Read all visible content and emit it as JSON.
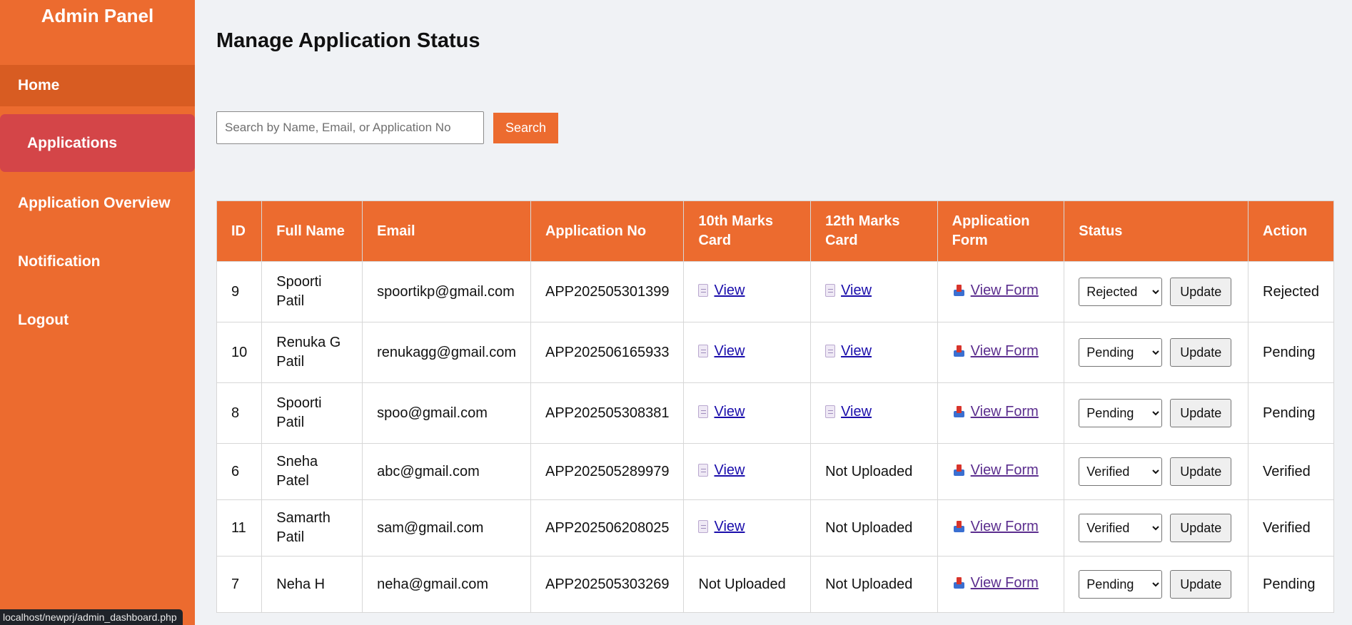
{
  "sidebar": {
    "title": "Admin Panel",
    "items": [
      {
        "label": "Home"
      },
      {
        "label": "Applications"
      },
      {
        "label": "Application Overview"
      },
      {
        "label": "Notification"
      },
      {
        "label": "Logout"
      }
    ]
  },
  "main": {
    "title": "Manage Application Status",
    "search": {
      "placeholder": "Search by Name, Email, or Application No",
      "value": "",
      "button_label": "Search"
    },
    "table": {
      "headers": [
        "ID",
        "Full Name",
        "Email",
        "Application No",
        "10th Marks Card",
        "12th Marks Card",
        "Application Form",
        "Status",
        "Action"
      ],
      "rows": [
        {
          "id": "9",
          "name": "Spoorti Patil",
          "email": "spoortikp@gmail.com",
          "app_no": "APP202505301399",
          "marks10": "View",
          "marks12": "View",
          "form": "View Form",
          "status_select": "Rejected",
          "update_label": "Update",
          "action": "Rejected"
        },
        {
          "id": "10",
          "name": "Renuka G Patil",
          "email": "renukagg@gmail.com",
          "app_no": "APP202506165933",
          "marks10": "View",
          "marks12": "View",
          "form": "View Form",
          "status_select": "Pending",
          "update_label": "Update",
          "action": "Pending"
        },
        {
          "id": "8",
          "name": "Spoorti Patil",
          "email": "spoo@gmail.com",
          "app_no": "APP202505308381",
          "marks10": "View",
          "marks12": "View",
          "form": "View Form",
          "status_select": "Pending",
          "update_label": "Update",
          "action": "Pending"
        },
        {
          "id": "6",
          "name": "Sneha Patel",
          "email": "abc@gmail.com",
          "app_no": "APP202505289979",
          "marks10": "View",
          "marks12": "Not Uploaded",
          "form": "View Form",
          "status_select": "Verified",
          "update_label": "Update",
          "action": "Verified"
        },
        {
          "id": "11",
          "name": "Samarth Patil",
          "email": "sam@gmail.com",
          "app_no": "APP202506208025",
          "marks10": "View",
          "marks12": "Not Uploaded",
          "form": "View Form",
          "status_select": "Verified",
          "update_label": "Update",
          "action": "Verified"
        },
        {
          "id": "7",
          "name": "Neha H",
          "email": "neha@gmail.com",
          "app_no": "APP202505303269",
          "marks10": "Not Uploaded",
          "marks12": "Not Uploaded",
          "form": "View Form",
          "status_select": "Pending",
          "update_label": "Update",
          "action": "Pending"
        }
      ]
    }
  },
  "status_bar": {
    "url": "localhost/newprj/admin_dashboard.php"
  },
  "colors": {
    "accent": "#ec6b2f",
    "active_nav": "#d44548",
    "home_nav": "#d85c22",
    "link": "#1a0dab",
    "visited_link": "#5b2d8e"
  },
  "icons": {
    "marks_card": "document-icon",
    "application_form": "form-upload-icon"
  }
}
